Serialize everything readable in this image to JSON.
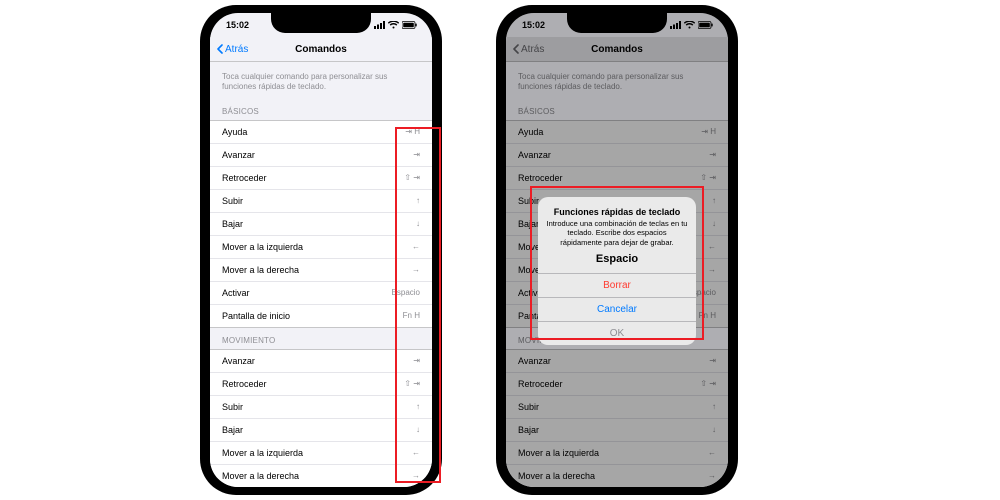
{
  "status": {
    "time": "15:02"
  },
  "nav": {
    "back": "Atrás",
    "title": "Comandos"
  },
  "hint": "Toca cualquier comando para personalizar sus funciones rápidas de teclado.",
  "sections": {
    "basic": {
      "header": "BÁSICOS",
      "items": [
        {
          "label": "Ayuda",
          "shortcut": "⇥ H"
        },
        {
          "label": "Avanzar",
          "shortcut": "⇥"
        },
        {
          "label": "Retroceder",
          "shortcut": "⇧ ⇥"
        },
        {
          "label": "Subir",
          "shortcut": "↑"
        },
        {
          "label": "Bajar",
          "shortcut": "↓"
        },
        {
          "label": "Mover a la izquierda",
          "shortcut": "←"
        },
        {
          "label": "Mover a la derecha",
          "shortcut": "→"
        },
        {
          "label": "Activar",
          "shortcut": "Espacio"
        },
        {
          "label": "Pantalla de inicio",
          "shortcut": "Fn H"
        }
      ]
    },
    "movement": {
      "header": "MOVIMIENTO",
      "items": [
        {
          "label": "Avanzar",
          "shortcut": "⇥"
        },
        {
          "label": "Retroceder",
          "shortcut": "⇧ ⇥"
        },
        {
          "label": "Subir",
          "shortcut": "↑"
        },
        {
          "label": "Bajar",
          "shortcut": "↓"
        },
        {
          "label": "Mover a la izquierda",
          "shortcut": "←"
        },
        {
          "label": "Mover a la derecha",
          "shortcut": "→"
        }
      ]
    }
  },
  "alert": {
    "title": "Funciones rápidas de teclado",
    "message": "Introduce una combinación de teclas en tu teclado. Escribe dos espacios rápidamente para dejar de grabar.",
    "current": "Espacio",
    "delete": "Borrar",
    "cancel": "Cancelar",
    "ok": "OK"
  }
}
